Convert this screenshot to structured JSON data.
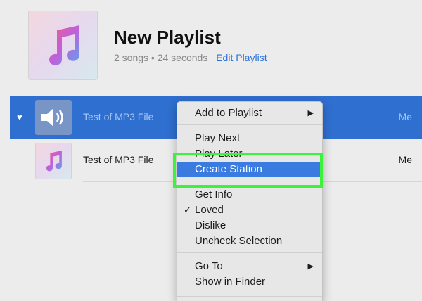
{
  "playlist": {
    "title": "New Playlist",
    "meta": "2 songs • 24 seconds",
    "edit_label": "Edit Playlist"
  },
  "tracks": [
    {
      "title": "Test of MP3 File",
      "artist": "Me",
      "loved": true,
      "selected": true,
      "now_playing": true
    },
    {
      "title": "Test of MP3 File",
      "artist": "Me",
      "loved": false,
      "selected": false,
      "now_playing": false
    }
  ],
  "context_menu": {
    "items": [
      {
        "label": "Add to Playlist",
        "submenu": true
      },
      {
        "label": "Play Next"
      },
      {
        "label": "Play Later"
      },
      {
        "label": "Create Station",
        "highlighted": true
      },
      {
        "label": "Get Info"
      },
      {
        "label": "Loved",
        "checked": true
      },
      {
        "label": "Dislike"
      },
      {
        "label": "Uncheck Selection"
      },
      {
        "label": "Go To",
        "submenu": true
      },
      {
        "label": "Show in Finder"
      }
    ]
  },
  "colors": {
    "selection_blue": "#2f6fd0",
    "menu_highlight": "#3a7be0",
    "callout_green": "#3df23a",
    "link_blue": "#2f73d6"
  },
  "icons": {
    "album_art": "music-note-icon",
    "now_playing": "speaker-icon",
    "loved": "heart-icon"
  }
}
